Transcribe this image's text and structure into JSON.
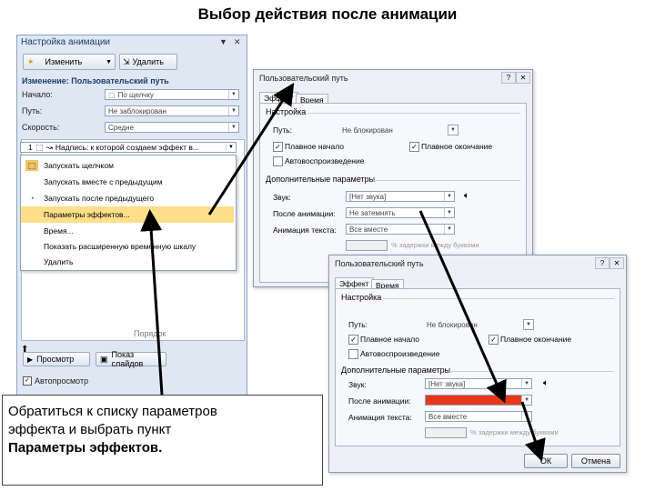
{
  "slide_title": "Выбор действия после анимации",
  "task_pane": {
    "title": "Настройка анимации",
    "change_button": "Изменить",
    "delete_button": "Удалить",
    "change_label": "Изменение: Пользовательский путь",
    "start_label": "Начало:",
    "start_value": "По щелчку",
    "path_label": "Путь:",
    "path_value": "Не заблокирован",
    "speed_label": "Скорость:",
    "speed_value": "Средне",
    "effect_item": "Надпись: к которой создаем эффект в...",
    "effect_index": "1",
    "menu": [
      {
        "label": "Запускать щелчком",
        "icon": "mouse-icon"
      },
      {
        "label": "Запускать вместе с предыдущим",
        "icon": "blank"
      },
      {
        "label": "Запускать после предыдущего",
        "icon": "clock-icon"
      },
      {
        "label": "Параметры эффектов...",
        "icon": "blank"
      },
      {
        "label": "Время...",
        "icon": "blank"
      },
      {
        "label": "Показать расширенную временную шкалу",
        "icon": "blank"
      },
      {
        "label": "Удалить",
        "icon": "blank"
      }
    ],
    "reorder_label": "Порядок",
    "play_button": "Просмотр",
    "slideshow_button": "Показ слайдов",
    "autopreview_label": "Автопросмотр"
  },
  "dialog_back": {
    "title": "Пользовательский путь",
    "tab_effect": "Эффект",
    "tab_time": "Время",
    "settings_group": "Настройка",
    "path_label": "Путь:",
    "path_value": "Не блокирован",
    "smooth_start": "Плавное начало",
    "smooth_end": "Плавное окончание",
    "auto_reverse": "Автовоспроизведение",
    "extras_group": "Дополнительные параметры",
    "sound_label": "Звук:",
    "sound_value": "[Нет звука]",
    "after_label": "После анимации:",
    "after_value": "Не затемнять",
    "text_anim_label": "Анимация текста:",
    "text_anim_value": "Все вместе",
    "delay_text": "% задержки между буквами"
  },
  "dialog_front": {
    "title": "Пользовательский путь",
    "tab_effect": "Эффект",
    "tab_time": "Время",
    "settings_group": "Настройка",
    "path_label": "Путь:",
    "path_value": "Не блокирован",
    "smooth_start": "Плавное начало",
    "smooth_end": "Плавное окончание",
    "auto_reverse": "Автовоспроизведение",
    "extras_group": "Дополнительные параметры",
    "sound_label": "Звук:",
    "sound_value": "[Нет звука]",
    "after_label": "После анимации:",
    "after_value": "",
    "after_color": "#e8381a",
    "text_anim_label": "Анимация текста:",
    "text_anim_value": "Все вместе",
    "delay_text": "% задержки между буквами",
    "ok_button": "ОК",
    "cancel_button": "Отмена"
  },
  "callout": {
    "line1": "Обратиться к списку параметров",
    "line2": "эффекта и выбрать пункт",
    "line3": "Параметры эффектов."
  }
}
